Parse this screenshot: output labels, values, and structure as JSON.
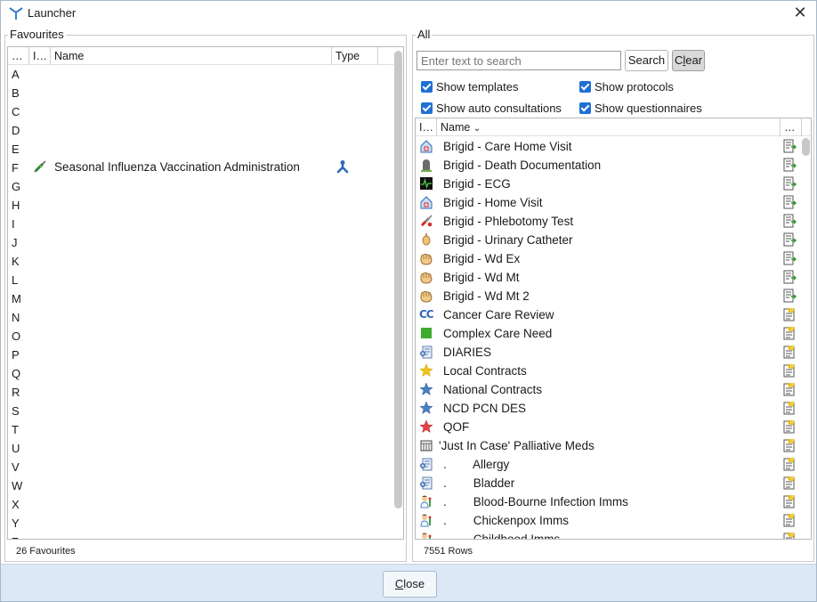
{
  "window": {
    "title": "Launcher",
    "close_glyph": "✕"
  },
  "favourites": {
    "legend": "Favourites",
    "columns": [
      "…",
      "I…",
      "Name",
      "Type"
    ],
    "letters": [
      "A",
      "B",
      "C",
      "D",
      "E",
      "F",
      "G",
      "H",
      "I",
      "J",
      "K",
      "L",
      "M",
      "N",
      "O",
      "P",
      "Q",
      "R",
      "S",
      "T",
      "U",
      "V",
      "W",
      "X",
      "Y",
      "Z"
    ],
    "items": [
      {
        "letter": "F",
        "icon": "syringe-icon",
        "name": "Seasonal Influenza Vaccination Administration",
        "type_icon": "protocol-icon"
      }
    ],
    "status": "26 Favourites"
  },
  "all": {
    "legend": "All",
    "search": {
      "placeholder": "Enter text to search",
      "value": ""
    },
    "search_button": "Search",
    "clear_button": {
      "before": "C",
      "mnemonic": "l",
      "after": "ear"
    },
    "checkboxes": [
      {
        "label": "Show templates",
        "checked": true
      },
      {
        "label": "Show protocols",
        "checked": true
      },
      {
        "label": "Show auto consultations",
        "checked": true
      },
      {
        "label": "Show questionnaires",
        "checked": true
      }
    ],
    "columns": [
      "I…",
      "Name",
      "…"
    ],
    "rows": [
      {
        "icon": "care-home-icon",
        "name": "Brigid - Care Home Visit",
        "type": "template-icon"
      },
      {
        "icon": "gravestone-icon",
        "name": "Brigid - Death Documentation",
        "type": "template-icon"
      },
      {
        "icon": "ecg-icon",
        "name": "Brigid - ECG",
        "type": "template-icon"
      },
      {
        "icon": "home-visit-icon",
        "name": "Brigid - Home Visit",
        "type": "template-icon"
      },
      {
        "icon": "blood-test-icon",
        "name": "Brigid - Phlebotomy Test",
        "type": "template-icon"
      },
      {
        "icon": "catheter-icon",
        "name": "Brigid - Urinary Catheter",
        "type": "template-icon"
      },
      {
        "icon": "hand-icon",
        "name": "Brigid - Wd Ex",
        "type": "template-icon"
      },
      {
        "icon": "hand-icon",
        "name": "Brigid - Wd Mt",
        "type": "template-icon"
      },
      {
        "icon": "hand-icon",
        "name": "Brigid - Wd Mt 2",
        "type": "template-icon"
      },
      {
        "icon": "cc-icon",
        "name": "Cancer Care Review",
        "type": "auto-consultation-icon"
      },
      {
        "icon": "green-square-icon",
        "name": "Complex Care Need",
        "type": "auto-consultation-icon"
      },
      {
        "icon": "diary-icon",
        "name": "DIARIES",
        "type": "auto-consultation-icon"
      },
      {
        "icon": "gold-star-icon",
        "name": "Local Contracts",
        "type": "auto-consultation-icon"
      },
      {
        "icon": "blue-star-icon",
        "name": "National Contracts",
        "type": "auto-consultation-icon"
      },
      {
        "icon": "blue-star-icon",
        "name": "NCD PCN DES",
        "type": "auto-consultation-icon"
      },
      {
        "icon": "red-star-icon",
        "name": "QOF",
        "type": "auto-consultation-icon"
      },
      {
        "icon": "pill-box-icon",
        "name": "'Just In Case' Palliative Meds",
        "type": "auto-consultation-icon"
      },
      {
        "icon": "diary-icon",
        "name": ".        Allergy",
        "type": "auto-consultation-icon"
      },
      {
        "icon": "diary-icon",
        "name": ".        Bladder",
        "type": "auto-consultation-icon"
      },
      {
        "icon": "nurse-icon",
        "name": ".        Blood-Bourne Infection Imms",
        "type": "auto-consultation-icon"
      },
      {
        "icon": "nurse-icon",
        "name": ".        Chickenpox Imms",
        "type": "auto-consultation-icon"
      },
      {
        "icon": "nurse-icon",
        "name": ".        Childhood Imms",
        "type": "auto-consultation-icon"
      }
    ],
    "status": "7551 Rows"
  },
  "footer": {
    "close_before": "",
    "close_mnemonic": "C",
    "close_after": "lose"
  },
  "colors": {
    "checkbox": "#1f6fd6",
    "footer": "#dce8f5",
    "title_bg": "#ffffff"
  }
}
